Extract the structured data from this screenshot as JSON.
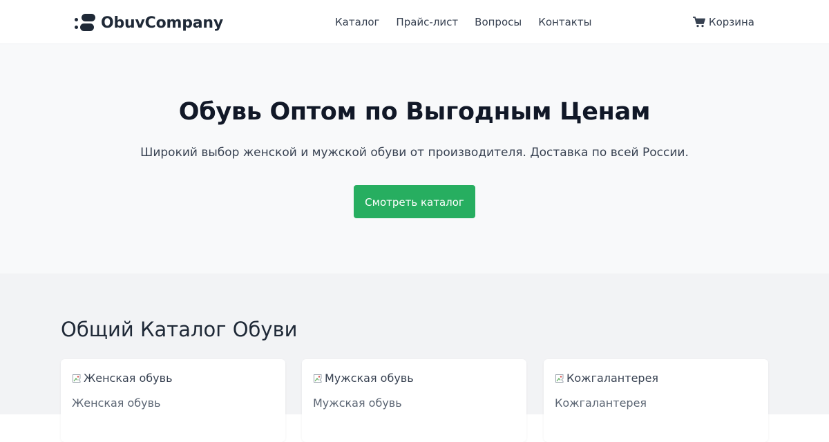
{
  "header": {
    "logo_text": "ObuvCompany",
    "logo_icon": "footprints-icon",
    "nav": [
      {
        "label": "Каталог"
      },
      {
        "label": "Прайс-лист"
      },
      {
        "label": "Вопросы"
      },
      {
        "label": "Контакты"
      }
    ],
    "cart": {
      "label": "Корзина",
      "icon": "shopping-cart-icon"
    }
  },
  "hero": {
    "title": "Обувь Оптом по Выгодным Ценам",
    "subtitle": "Широкий выбор женской и мужской обуви от производителя. Доставка по всей России.",
    "button_label": "Смотреть каталог"
  },
  "catalog": {
    "title": "Общий Каталог Обуви",
    "cards": [
      {
        "image_alt": "Женская обувь",
        "name": "Женская обувь"
      },
      {
        "image_alt": "Мужская обувь",
        "name": "Мужская обувь"
      },
      {
        "image_alt": "Кожгалантерея",
        "name": "Кожгалантерея"
      }
    ]
  },
  "colors": {
    "accent": "#27ae60",
    "hero_bg": "#f8f9fa",
    "catalog_bg": "#f2f3f5",
    "text_dark": "#111827"
  }
}
